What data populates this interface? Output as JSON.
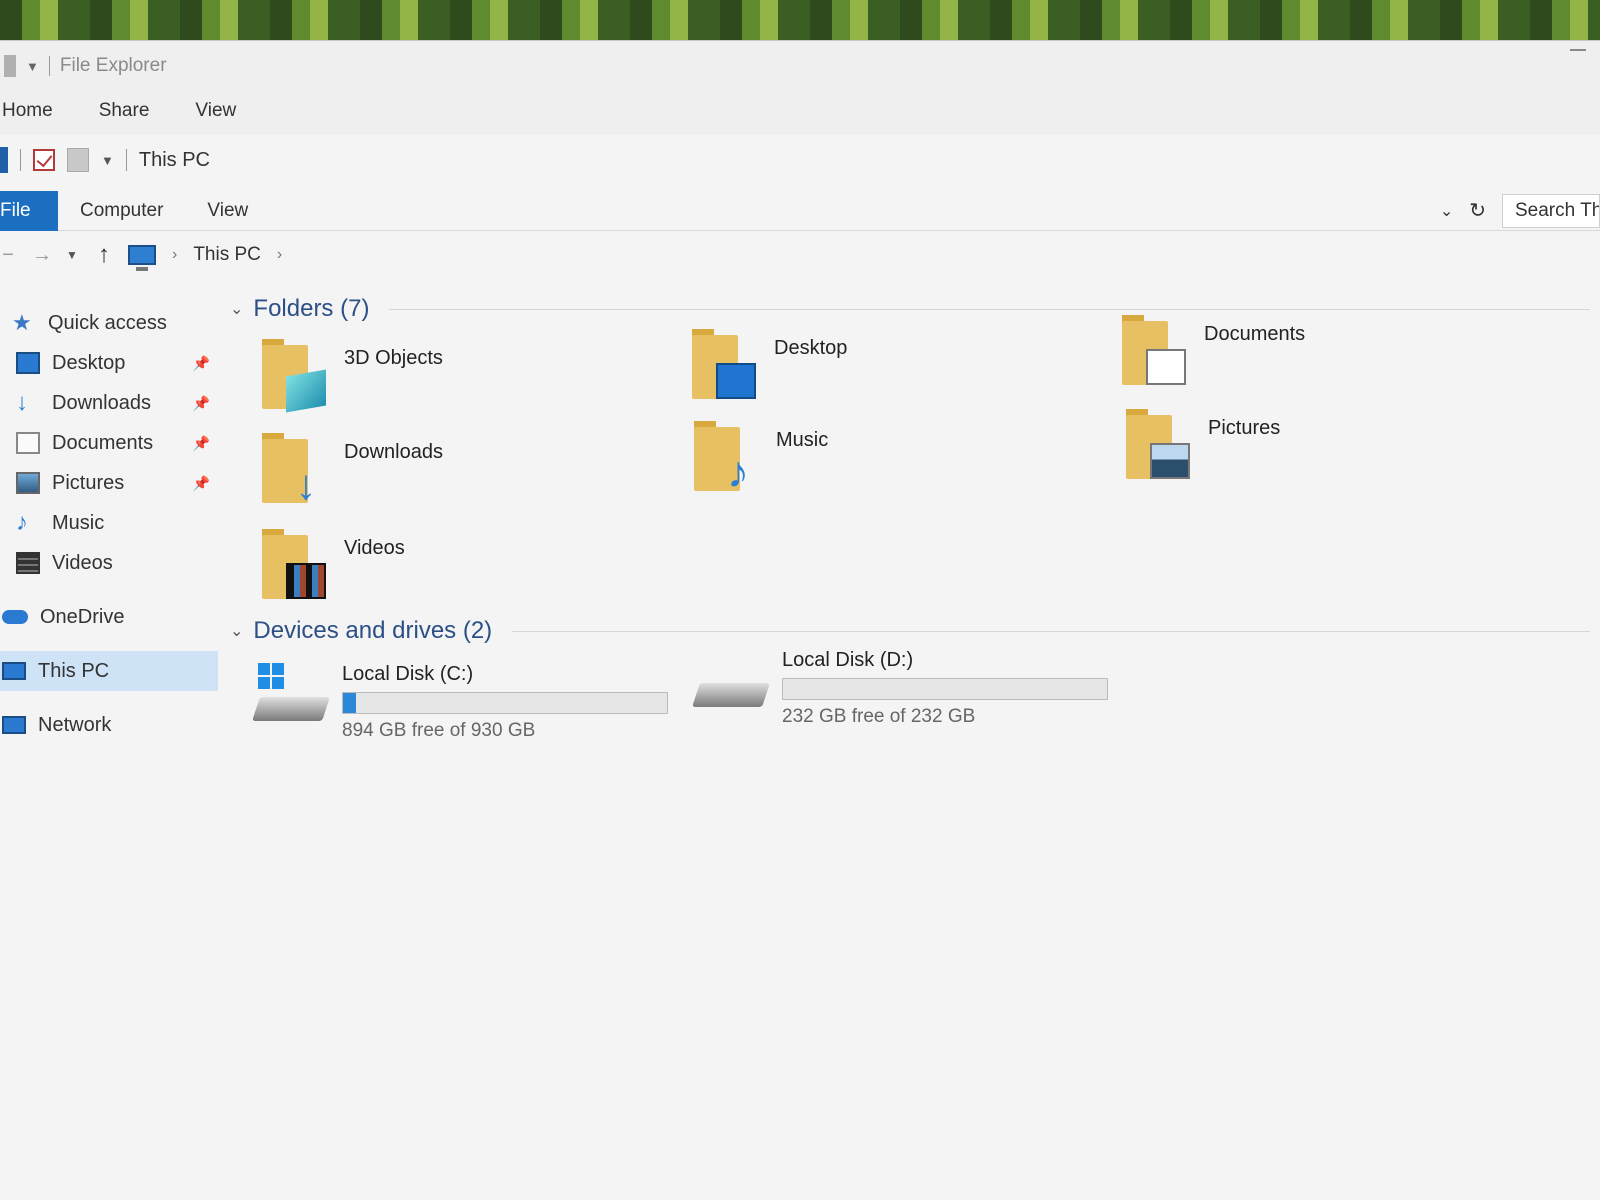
{
  "back_window": {
    "title": "File Explorer",
    "tabs": [
      "Home",
      "Share",
      "View"
    ]
  },
  "window": {
    "title": "This PC",
    "ribbon_tabs": [
      "File",
      "Computer",
      "View"
    ],
    "search_placeholder": "Search Thi",
    "breadcrumb": [
      "This PC"
    ]
  },
  "navpane": {
    "quick_access": "Quick access",
    "quick_items": [
      {
        "label": "Desktop",
        "icon": "desktop-icon",
        "pinned": true
      },
      {
        "label": "Downloads",
        "icon": "downloads-icon",
        "pinned": true
      },
      {
        "label": "Documents",
        "icon": "documents-icon",
        "pinned": true
      },
      {
        "label": "Pictures",
        "icon": "pictures-icon",
        "pinned": true
      },
      {
        "label": "Music",
        "icon": "music-icon",
        "pinned": false
      },
      {
        "label": "Videos",
        "icon": "videos-icon",
        "pinned": false
      }
    ],
    "onedrive": "OneDrive",
    "this_pc": "This PC",
    "network": "Network"
  },
  "content": {
    "folders_header": "Folders (7)",
    "folders": [
      {
        "name": "3D Objects",
        "icon": "3d-objects-icon"
      },
      {
        "name": "Desktop",
        "icon": "desktop-folder-icon"
      },
      {
        "name": "Documents",
        "icon": "documents-folder-icon"
      },
      {
        "name": "Downloads",
        "icon": "downloads-folder-icon"
      },
      {
        "name": "Music",
        "icon": "music-folder-icon"
      },
      {
        "name": "Pictures",
        "icon": "pictures-folder-icon"
      },
      {
        "name": "Videos",
        "icon": "videos-folder-icon"
      }
    ],
    "drives_header": "Devices and drives (2)",
    "drives": [
      {
        "name": "Local Disk (C:)",
        "free": "894 GB free of 930 GB",
        "used_fraction": 0.039,
        "icon": "windows-drive-icon"
      },
      {
        "name": "Local Disk (D:)",
        "free": "232 GB free of 232 GB",
        "used_fraction": 0.0,
        "icon": "drive-icon"
      }
    ]
  },
  "colors": {
    "accent": "#1c6ec0",
    "selection": "#cfe3f7",
    "usage_fill": "#2b87d8",
    "group_header": "#2c4f86"
  }
}
